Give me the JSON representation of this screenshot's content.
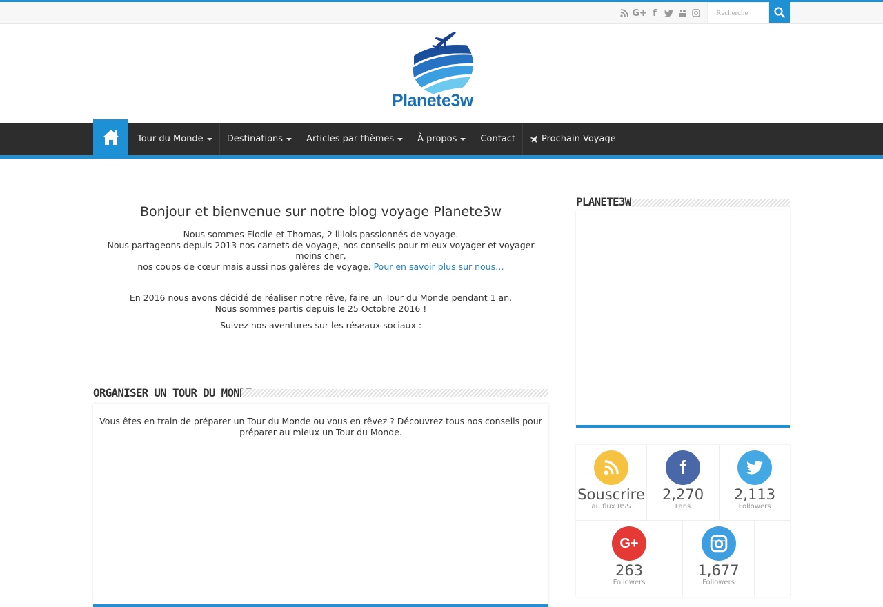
{
  "topbar": {
    "social_icons": [
      "rss-icon",
      "google-plus-icon",
      "facebook-icon",
      "twitter-icon",
      "youtube-icon",
      "instagram-icon"
    ],
    "search_placeholder": "Recherche"
  },
  "logo": {
    "text_part1": "Planete3",
    "text_part2": "w"
  },
  "nav": {
    "items": [
      {
        "label": "Tour du Monde",
        "dropdown": true
      },
      {
        "label": "Destinations",
        "dropdown": true
      },
      {
        "label": "Articles par thèmes",
        "dropdown": true
      },
      {
        "label": "À propos",
        "dropdown": true
      },
      {
        "label": "Contact",
        "dropdown": false
      },
      {
        "label": "Prochain Voyage",
        "dropdown": false,
        "icon": "plane-icon"
      }
    ]
  },
  "welcome": {
    "title": "Bonjour et bienvenue sur notre blog voyage Planete3w",
    "line1": "Nous sommes Elodie et Thomas, 2 lillois passionnés de voyage.",
    "line2": "Nous partageons depuis 2013 nos carnets de voyage, nos conseils pour mieux voyager et voyager moins cher,",
    "line3": "nos coups de cœur mais aussi nos galères de voyage.",
    "link": "Pour en savoir plus sur nous…",
    "line4": "En 2016 nous avons décidé de réaliser notre rêve, faire un Tour du Monde pendant 1 an.",
    "line5": "Nous sommes partis depuis le 25 Octobre 2016 !",
    "line6": "Suivez nos aventures sur les réseaux sociaux :"
  },
  "section": {
    "title": "ORGANISER UN TOUR DU MONDE",
    "text1": "Vous êtes en train de préparer un Tour du Monde ou vous en rêvez ? Découvrez tous nos conseils pour",
    "text2": "préparer au mieux un Tour du Monde."
  },
  "sidebar": {
    "title": "PLANETE3W",
    "counters": [
      {
        "icon": "rss-icon",
        "number": "Souscrire",
        "label": "au flux RSS",
        "color": "#f5c242"
      },
      {
        "icon": "facebook-icon",
        "number": "2,270",
        "label": "Fans",
        "color": "#4a67a8"
      },
      {
        "icon": "twitter-icon",
        "number": "2,113",
        "label": "Followers",
        "color": "#44a9e3"
      },
      {
        "icon": "google-plus-icon",
        "number": "263",
        "label": "Followers",
        "color": "#e53935"
      },
      {
        "icon": "instagram-icon",
        "number": "1,677",
        "label": "Followers",
        "color": "#3f9ee0"
      }
    ]
  }
}
